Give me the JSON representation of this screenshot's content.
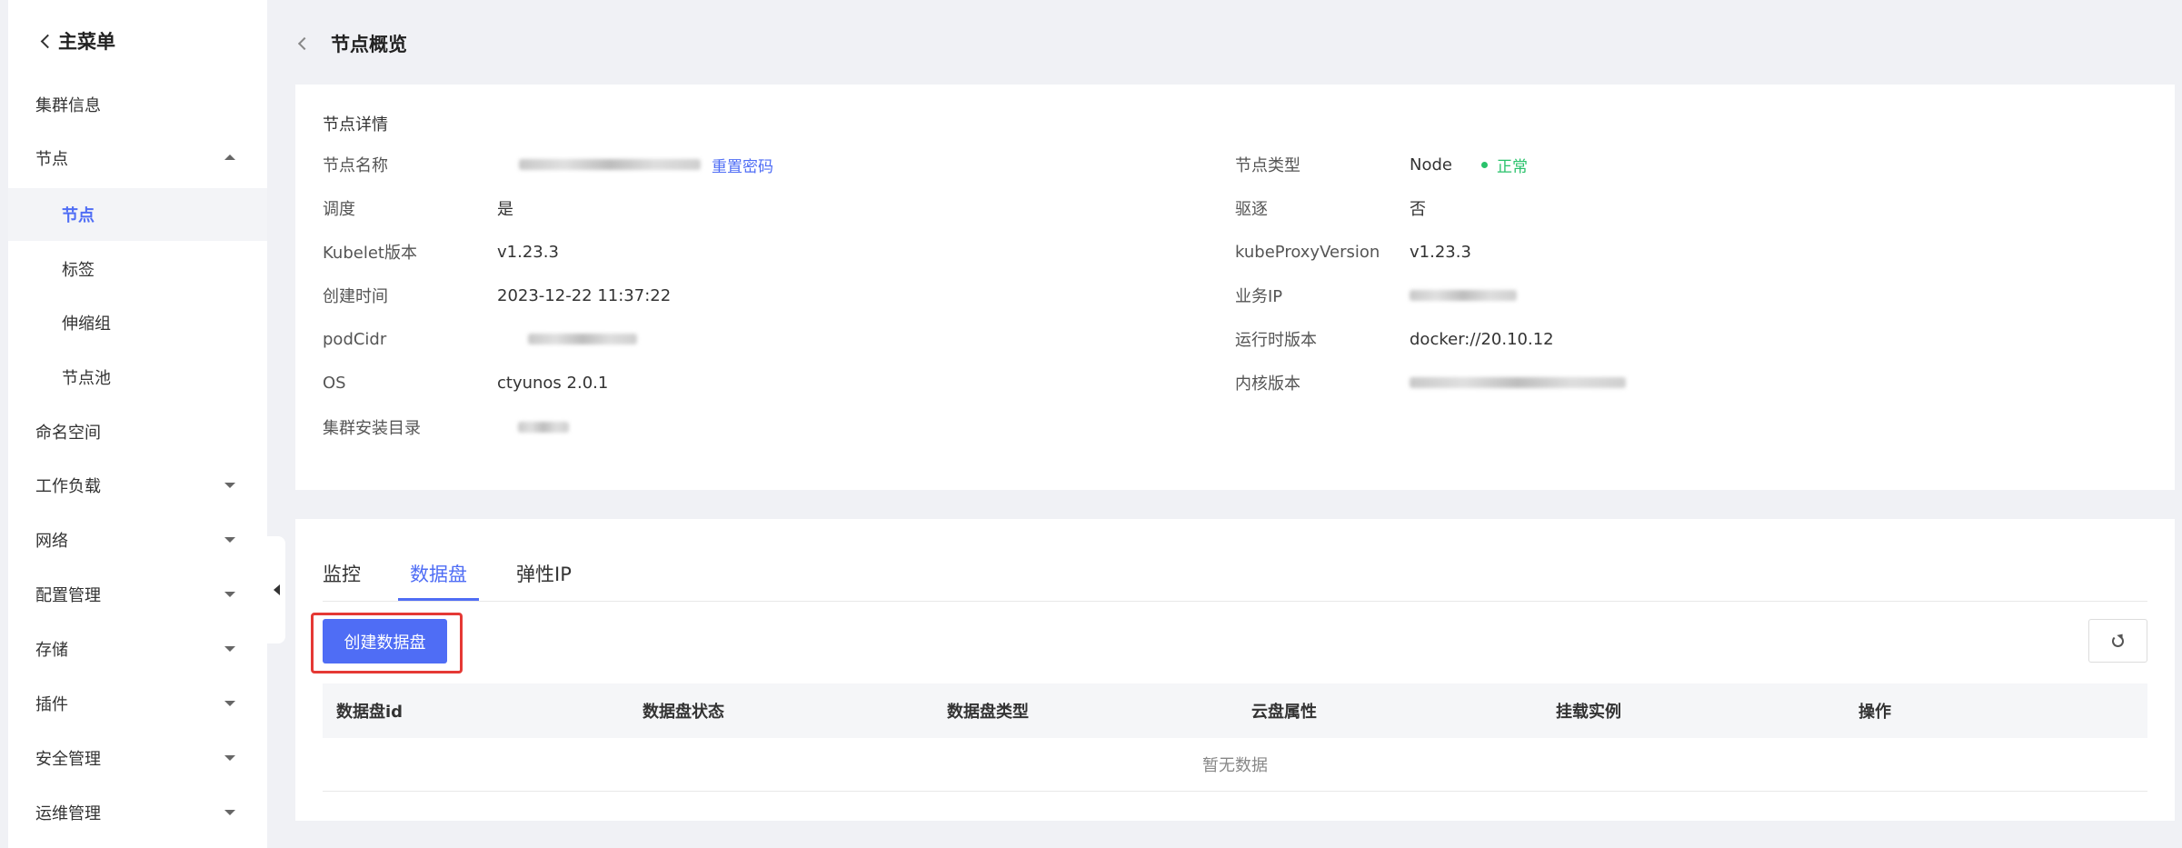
{
  "sidebar": {
    "header": "主菜单",
    "items": [
      {
        "label": "集群信息",
        "caret": "none"
      },
      {
        "label": "节点",
        "caret": "up"
      },
      {
        "label": "节点",
        "sub": true,
        "active": true
      },
      {
        "label": "标签",
        "sub": true
      },
      {
        "label": "伸缩组",
        "sub": true
      },
      {
        "label": "节点池",
        "sub": true
      },
      {
        "label": "命名空间",
        "caret": "none"
      },
      {
        "label": "工作负载",
        "caret": "down"
      },
      {
        "label": "网络",
        "caret": "down"
      },
      {
        "label": "配置管理",
        "caret": "down"
      },
      {
        "label": "存储",
        "caret": "down"
      },
      {
        "label": "插件",
        "caret": "down"
      },
      {
        "label": "安全管理",
        "caret": "down"
      },
      {
        "label": "运维管理",
        "caret": "down"
      }
    ]
  },
  "page": {
    "title": "节点概览"
  },
  "detail": {
    "section_title": "节点详情",
    "left": [
      {
        "label": "节点名称",
        "value": "",
        "link": "重置密码"
      },
      {
        "label": "调度",
        "value": "是"
      },
      {
        "label": "Kubelet版本",
        "value": "v1.23.3"
      },
      {
        "label": "创建时间",
        "value": "2023-12-22 11:37:22"
      },
      {
        "label": "podCidr",
        "value": ""
      },
      {
        "label": "OS",
        "value": "ctyunos 2.0.1"
      },
      {
        "label": "集群安装目录",
        "value": ""
      }
    ],
    "right": [
      {
        "label": "节点类型",
        "value": "Node",
        "status": "正常"
      },
      {
        "label": "驱逐",
        "value": "否"
      },
      {
        "label": "kubeProxyVersion",
        "value": "v1.23.3"
      },
      {
        "label": "业务IP",
        "value": ""
      },
      {
        "label": "运行时版本",
        "value": "docker://20.10.12"
      },
      {
        "label": "内核版本",
        "value": ""
      }
    ]
  },
  "tabs": [
    {
      "label": "监控",
      "active": false
    },
    {
      "label": "数据盘",
      "active": true
    },
    {
      "label": "弹性IP",
      "active": false
    }
  ],
  "toolbar": {
    "create_label": "创建数据盘"
  },
  "table": {
    "columns": [
      "数据盘id",
      "数据盘状态",
      "数据盘类型",
      "云盘属性",
      "挂载实例",
      "操作"
    ],
    "empty_text": "暂无数据"
  },
  "colors": {
    "accent": "#4f6df5",
    "status_ok": "#29c26b",
    "highlight_border": "#e53935"
  }
}
